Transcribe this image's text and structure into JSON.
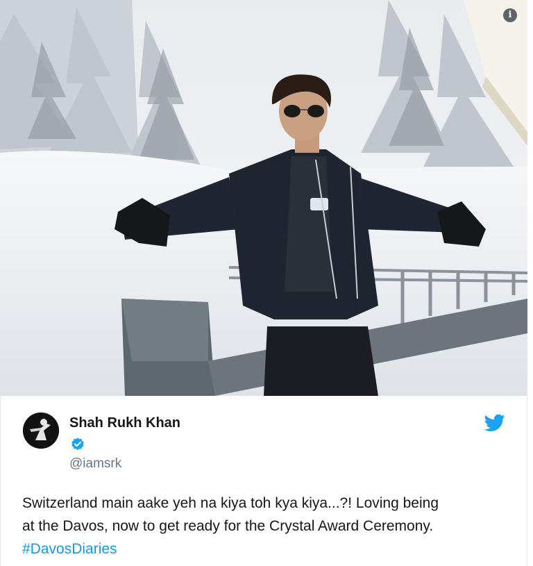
{
  "tweet": {
    "author_name": "Shah Rukh Khan",
    "handle": "@iamsrk",
    "text_line1": "Switzerland main aake yeh na kiya toh kya kiya...?! Loving being",
    "text_line2": "at the Davos, now to get ready for the Crystal Award Ceremony.",
    "hashtag": "#DavosDiaries",
    "verified": true
  },
  "icons": {
    "info": "info-icon",
    "verified": "verified-badge-icon",
    "twitter": "twitter-bird-icon"
  },
  "colors": {
    "link": "#1b95e0",
    "text": "#14171a",
    "secondary": "#657786",
    "verified": "#1da1f2"
  }
}
